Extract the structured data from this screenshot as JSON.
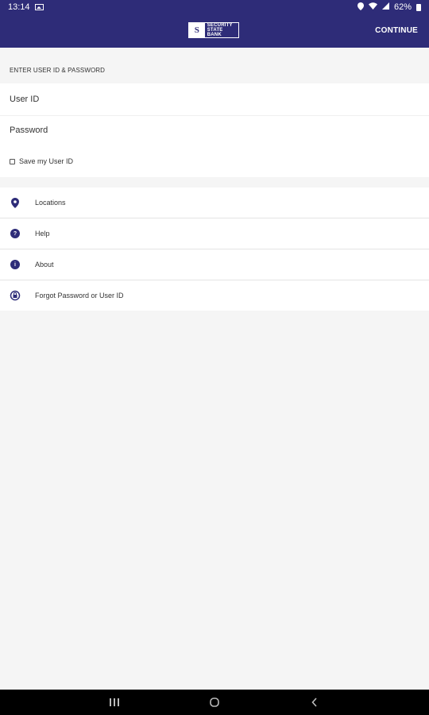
{
  "status_bar": {
    "time": "13:14",
    "battery": "62%"
  },
  "app_bar": {
    "logo_mark": "S",
    "logo_text_line1": "SECURITY",
    "logo_text_line2": "STATE BANK",
    "continue_label": "CONTINUE"
  },
  "login": {
    "section_title": "ENTER USER ID & PASSWORD",
    "user_id_placeholder": "User ID",
    "password_placeholder": "Password",
    "save_label": "Save my User ID"
  },
  "menu": {
    "items": [
      {
        "label": "Locations",
        "icon": "map-pin-icon"
      },
      {
        "label": "Help",
        "icon": "question-icon"
      },
      {
        "label": "About",
        "icon": "info-icon"
      },
      {
        "label": "Forgot Password or User ID",
        "icon": "reset-lock-icon"
      }
    ]
  },
  "colors": {
    "primary": "#2e2c78",
    "background": "#f5f5f5"
  }
}
